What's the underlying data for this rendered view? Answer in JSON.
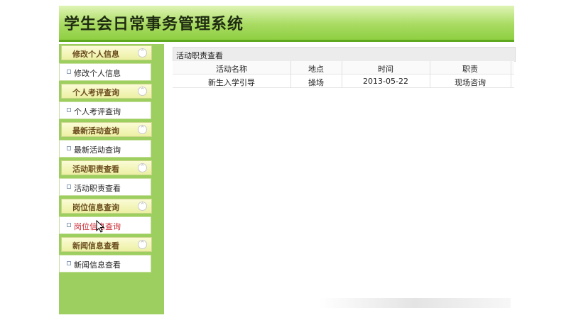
{
  "app": {
    "title": "学生会日常事务管理系统"
  },
  "sidebar": {
    "groups": [
      {
        "header": "修改个人信息",
        "item": "修改个人信息",
        "active": false
      },
      {
        "header": "个人考评查询",
        "item": "个人考评查询",
        "active": false
      },
      {
        "header": "最新活动查询",
        "item": "最新活动查询",
        "active": false
      },
      {
        "header": "活动职责查看",
        "item": "活动职责查看",
        "active": false
      },
      {
        "header": "岗位信息查询",
        "item": "岗位信息查询",
        "active": true
      },
      {
        "header": "新闻信息查看",
        "item": "新闻信息查看",
        "active": false
      }
    ],
    "collapse_glyph": "⌃",
    "icon": "collapse-up-icon"
  },
  "content": {
    "title": "活动职责查看",
    "table": {
      "headers": [
        "活动名称",
        "地点",
        "时间",
        "职责"
      ],
      "rows": [
        [
          "新生入学引导",
          "操场",
          "2013-05-22",
          "现场咨询"
        ]
      ]
    }
  },
  "colors": {
    "header": "#a9db62",
    "sidebar": "#9ccf5f",
    "active_item": "#c8232c"
  }
}
